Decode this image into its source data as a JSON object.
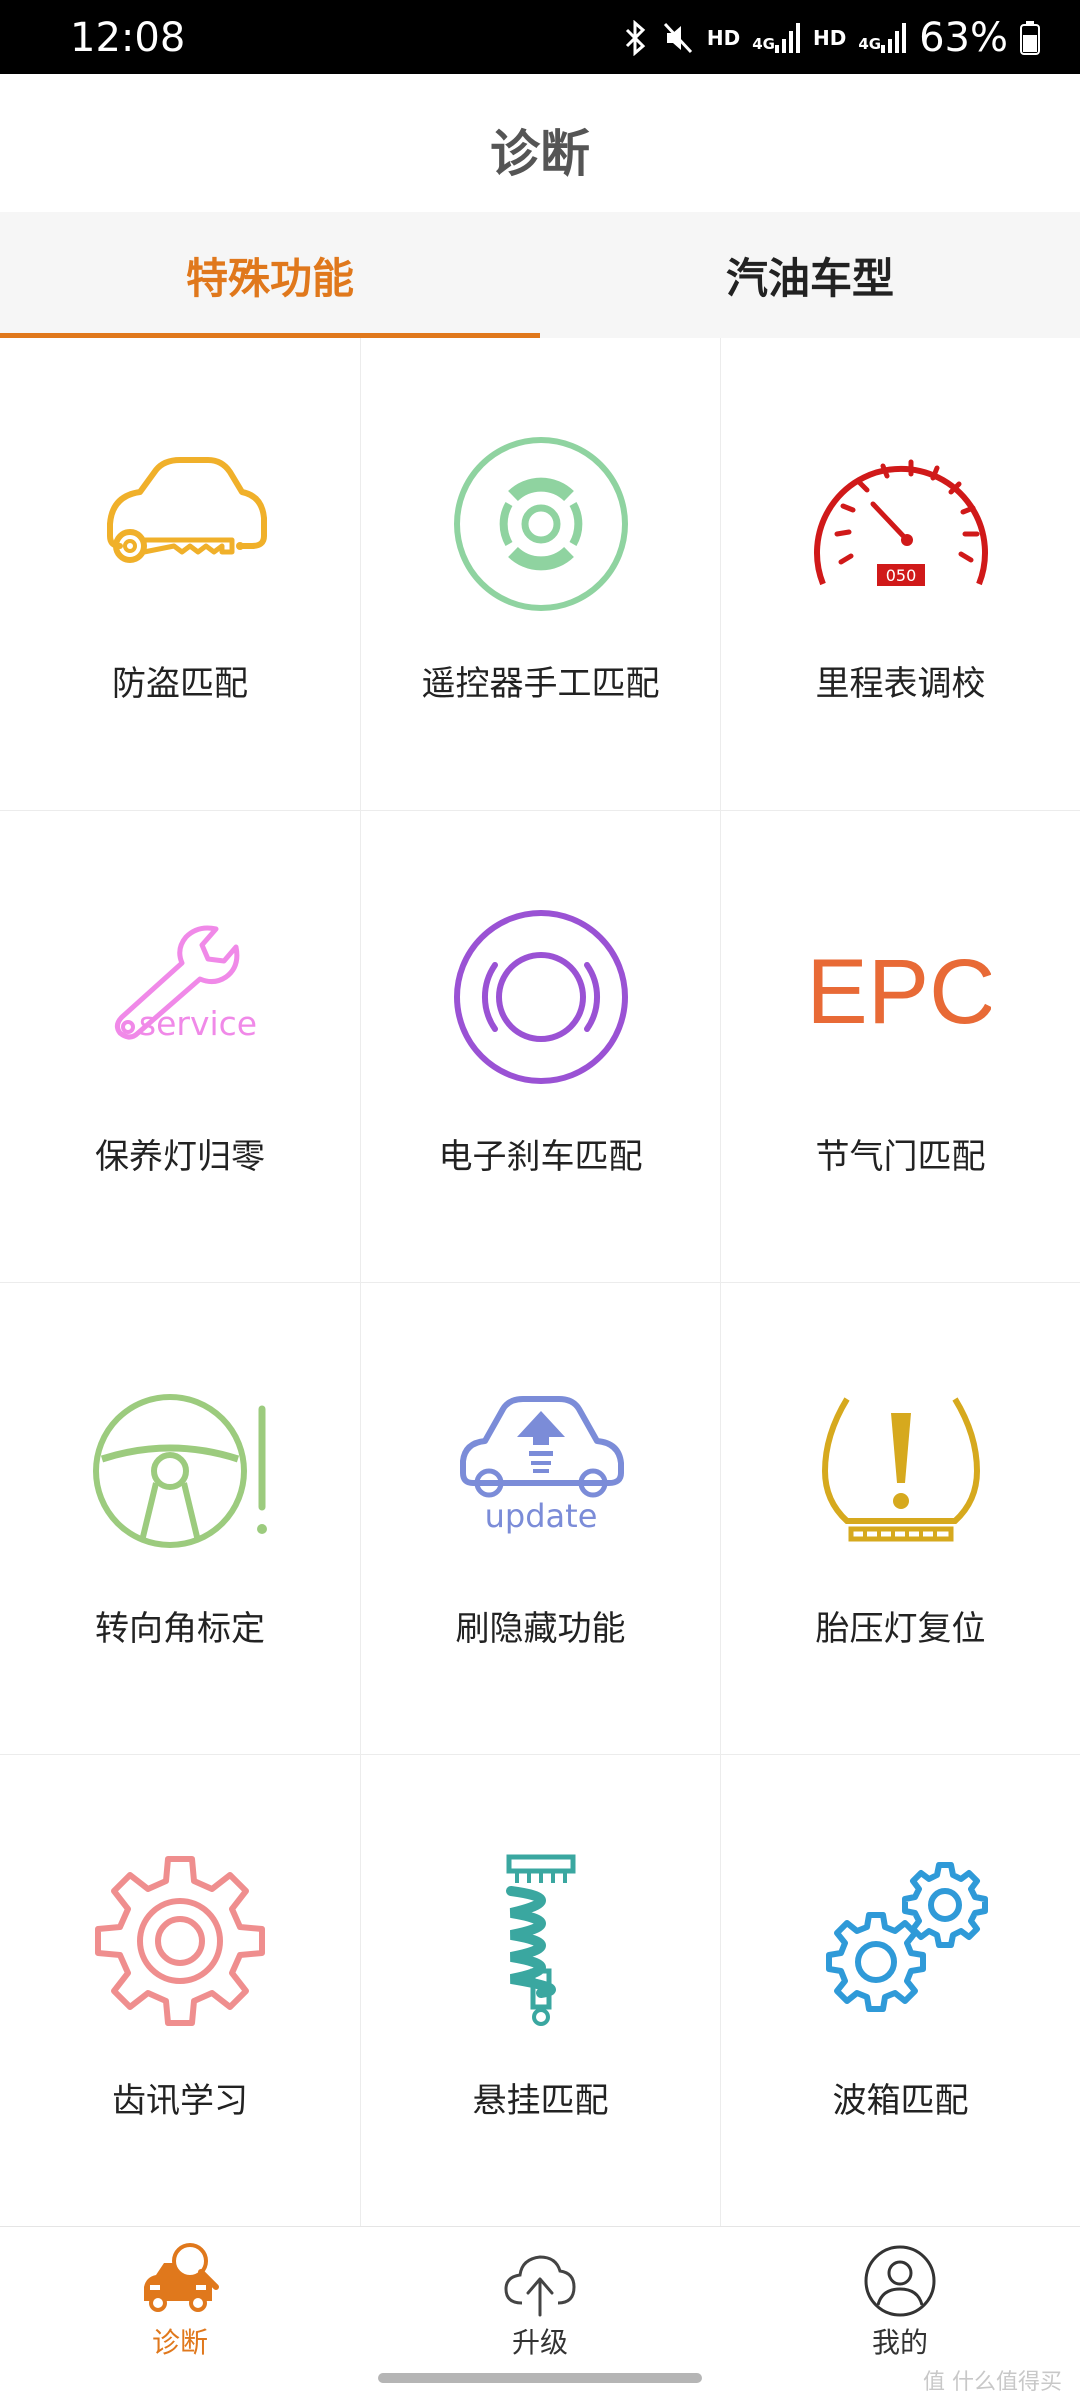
{
  "status_bar": {
    "time": "12:08",
    "network_1": "HD",
    "network_1_type": "4G",
    "network_2": "HD",
    "network_2_type": "4G",
    "battery": "63%",
    "icons": [
      "bluetooth-icon",
      "mute-icon",
      "signal-icon",
      "battery-icon"
    ]
  },
  "header": {
    "title": "诊断"
  },
  "tabs": [
    {
      "label": "特殊功能",
      "active": true
    },
    {
      "label": "汽油车型",
      "active": false
    }
  ],
  "accent_color": "#e0781c",
  "functions": [
    {
      "label": "防盗匹配",
      "icon": "car-key-icon",
      "color": "#f0b02a"
    },
    {
      "label": "遥控器手工匹配",
      "icon": "remote-icon",
      "color": "#8fd3a0"
    },
    {
      "label": "里程表调校",
      "icon": "speedometer-icon",
      "color": "#d01919",
      "icon_text": "050"
    },
    {
      "label": "保养灯归零",
      "icon": "service-wrench-icon",
      "color": "#f089e8",
      "icon_text": "service"
    },
    {
      "label": "电子刹车匹配",
      "icon": "brake-disc-icon",
      "color": "#9a52d4"
    },
    {
      "label": "节气门匹配",
      "icon": "epc-icon",
      "color": "#e86a36",
      "icon_text": "EPC"
    },
    {
      "label": "转向角标定",
      "icon": "steering-wheel-icon",
      "color": "#9ccb7e"
    },
    {
      "label": "刷隐藏功能",
      "icon": "car-update-icon",
      "color": "#7b8cd8",
      "icon_text": "update"
    },
    {
      "label": "胎压灯复位",
      "icon": "tire-pressure-icon",
      "color": "#d6a91e"
    },
    {
      "label": "齿讯学习",
      "icon": "gear-icon",
      "color": "#ef8e8e"
    },
    {
      "label": "悬挂匹配",
      "icon": "suspension-icon",
      "color": "#3aa7a0"
    },
    {
      "label": "波箱匹配",
      "icon": "gears-icon",
      "color": "#2f9ad8"
    }
  ],
  "bottom_nav": [
    {
      "label": "诊断",
      "icon": "diagnose-icon",
      "active": true
    },
    {
      "label": "升级",
      "icon": "cloud-upload-icon",
      "active": false
    },
    {
      "label": "我的",
      "icon": "profile-icon",
      "active": false
    }
  ],
  "watermark": "值 什么值得买"
}
